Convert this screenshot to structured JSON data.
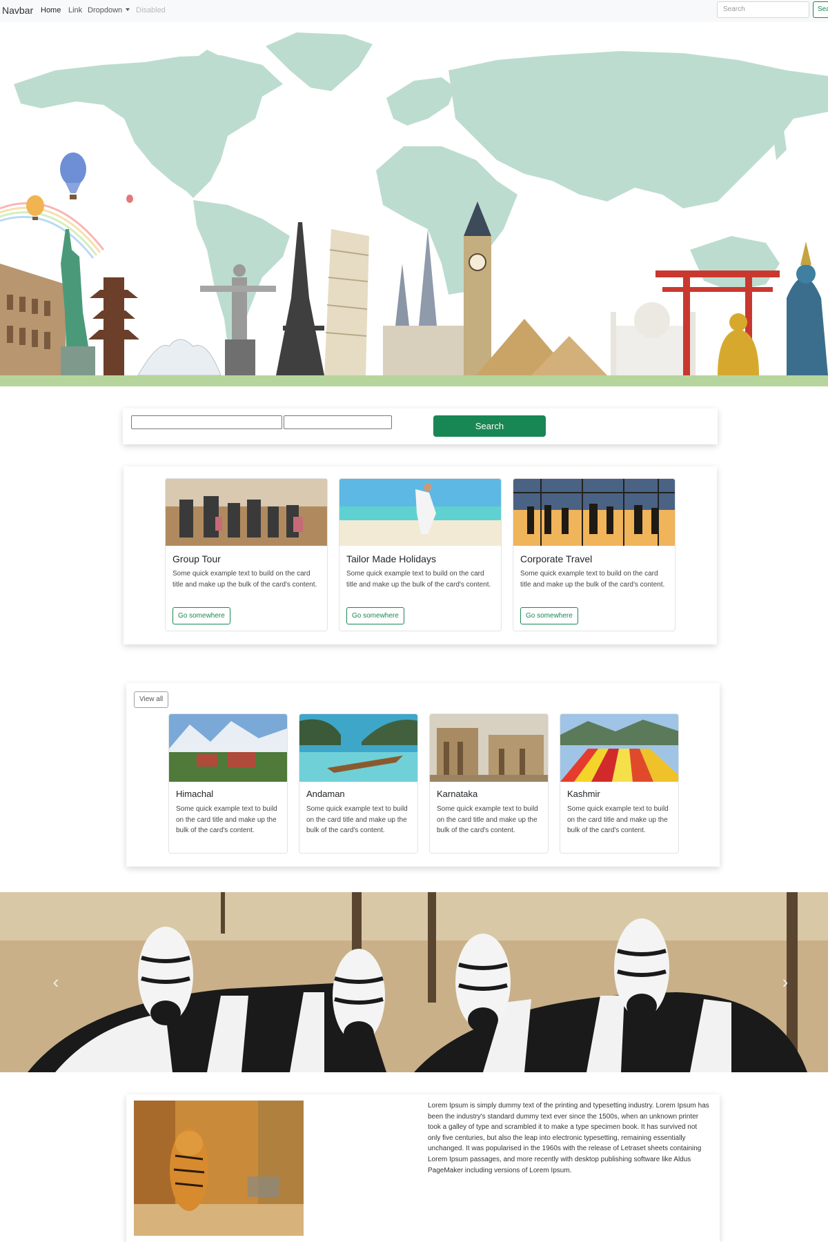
{
  "navbar": {
    "brand": "Navbar",
    "links": [
      {
        "label": "Home"
      },
      {
        "label": "Link"
      },
      {
        "label": "Dropdown"
      },
      {
        "label": "Disabled"
      }
    ],
    "search_placeholder": "Search",
    "search_button": "Search"
  },
  "hero": {
    "image": "world-map-with-landmarks",
    "colors": {
      "map": "#bddcd0",
      "ground": "#b6d59c"
    }
  },
  "search_panel": {
    "button_label": "Search",
    "button_color": "#198754"
  },
  "services": [
    {
      "title": "Group Tour",
      "text": "Some quick example text to build on the card title and make up the bulk of the card's content.",
      "button": "Go somewhere"
    },
    {
      "title": "Tailor Made Holidays",
      "text": "Some quick example text to build on the card title and make up the bulk of the card's content.",
      "button": "Go somewhere"
    },
    {
      "title": "Corporate Travel",
      "text": "Some quick example text to build on the card title and make up the bulk of the card's content.",
      "button": "Go somewhere"
    }
  ],
  "destinations": {
    "view_all": "View all",
    "items": [
      {
        "title": "Himachal",
        "text": "Some quick example text to build on the card title and make up the bulk of the card's content."
      },
      {
        "title": "Andaman",
        "text": "Some quick example text to build on the card title and make up the bulk of the card's content."
      },
      {
        "title": "Karnataka",
        "text": "Some quick example text to build on the card title and make up the bulk of the card's content."
      },
      {
        "title": "Kashmir",
        "text": "Some quick example text to build on the card title and make up the bulk of the card's content."
      }
    ]
  },
  "carousel": {
    "image": "zebras",
    "prev_icon": "chevron-left-icon",
    "next_icon": "chevron-right-icon"
  },
  "about": {
    "image": "tiger",
    "paragraph": "Lorem Ipsum is simply dummy text of the printing and typesetting industry. Lorem Ipsum has been the industry's standard dummy text ever since the 1500s, when an unknown printer took a galley of type and scrambled it to make a type specimen book. It has survived not only five centuries, but also the leap into electronic typesetting, remaining essentially unchanged. It was popularised in the 1960s with the release of Letraset sheets containing Lorem Ipsum passages, and more recently with desktop publishing software like Aldus PageMaker including versions of Lorem Ipsum."
  },
  "theme": {
    "accent": "#198754",
    "navbar_bg": "#f8f9fa"
  }
}
